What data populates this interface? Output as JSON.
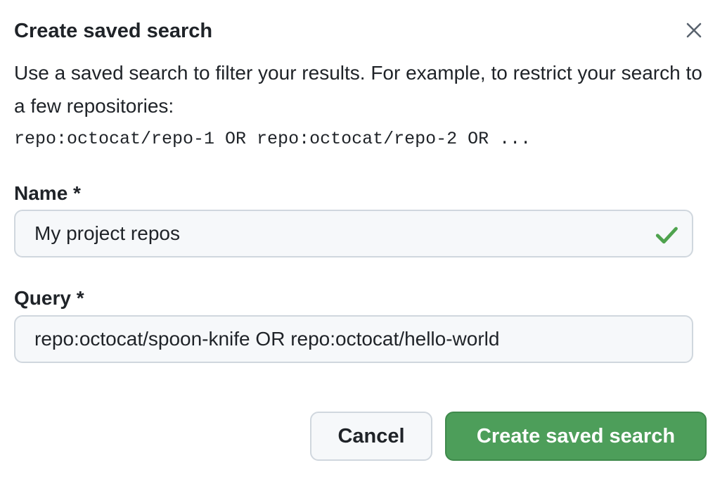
{
  "dialog": {
    "title": "Create saved search",
    "description": "Use a saved search to filter your results. For example, to restrict your search to a few repositories:",
    "example_query": "repo:octocat/repo-1 OR repo:octocat/repo-2 OR ...",
    "close_icon": "x-close-icon"
  },
  "form": {
    "name_label": "Name *",
    "name_value": "My project repos",
    "name_valid_icon": "check-icon",
    "query_label": "Query *",
    "query_value": "repo:octocat/spoon-knife OR repo:octocat/hello-world"
  },
  "actions": {
    "cancel_label": "Cancel",
    "create_label": "Create saved search"
  },
  "colors": {
    "primary_button": "#4d9e5a",
    "valid_check": "#4fa34e",
    "text": "#1f2328",
    "field_bg": "#f6f8fa",
    "field_border": "#d0d7de"
  }
}
